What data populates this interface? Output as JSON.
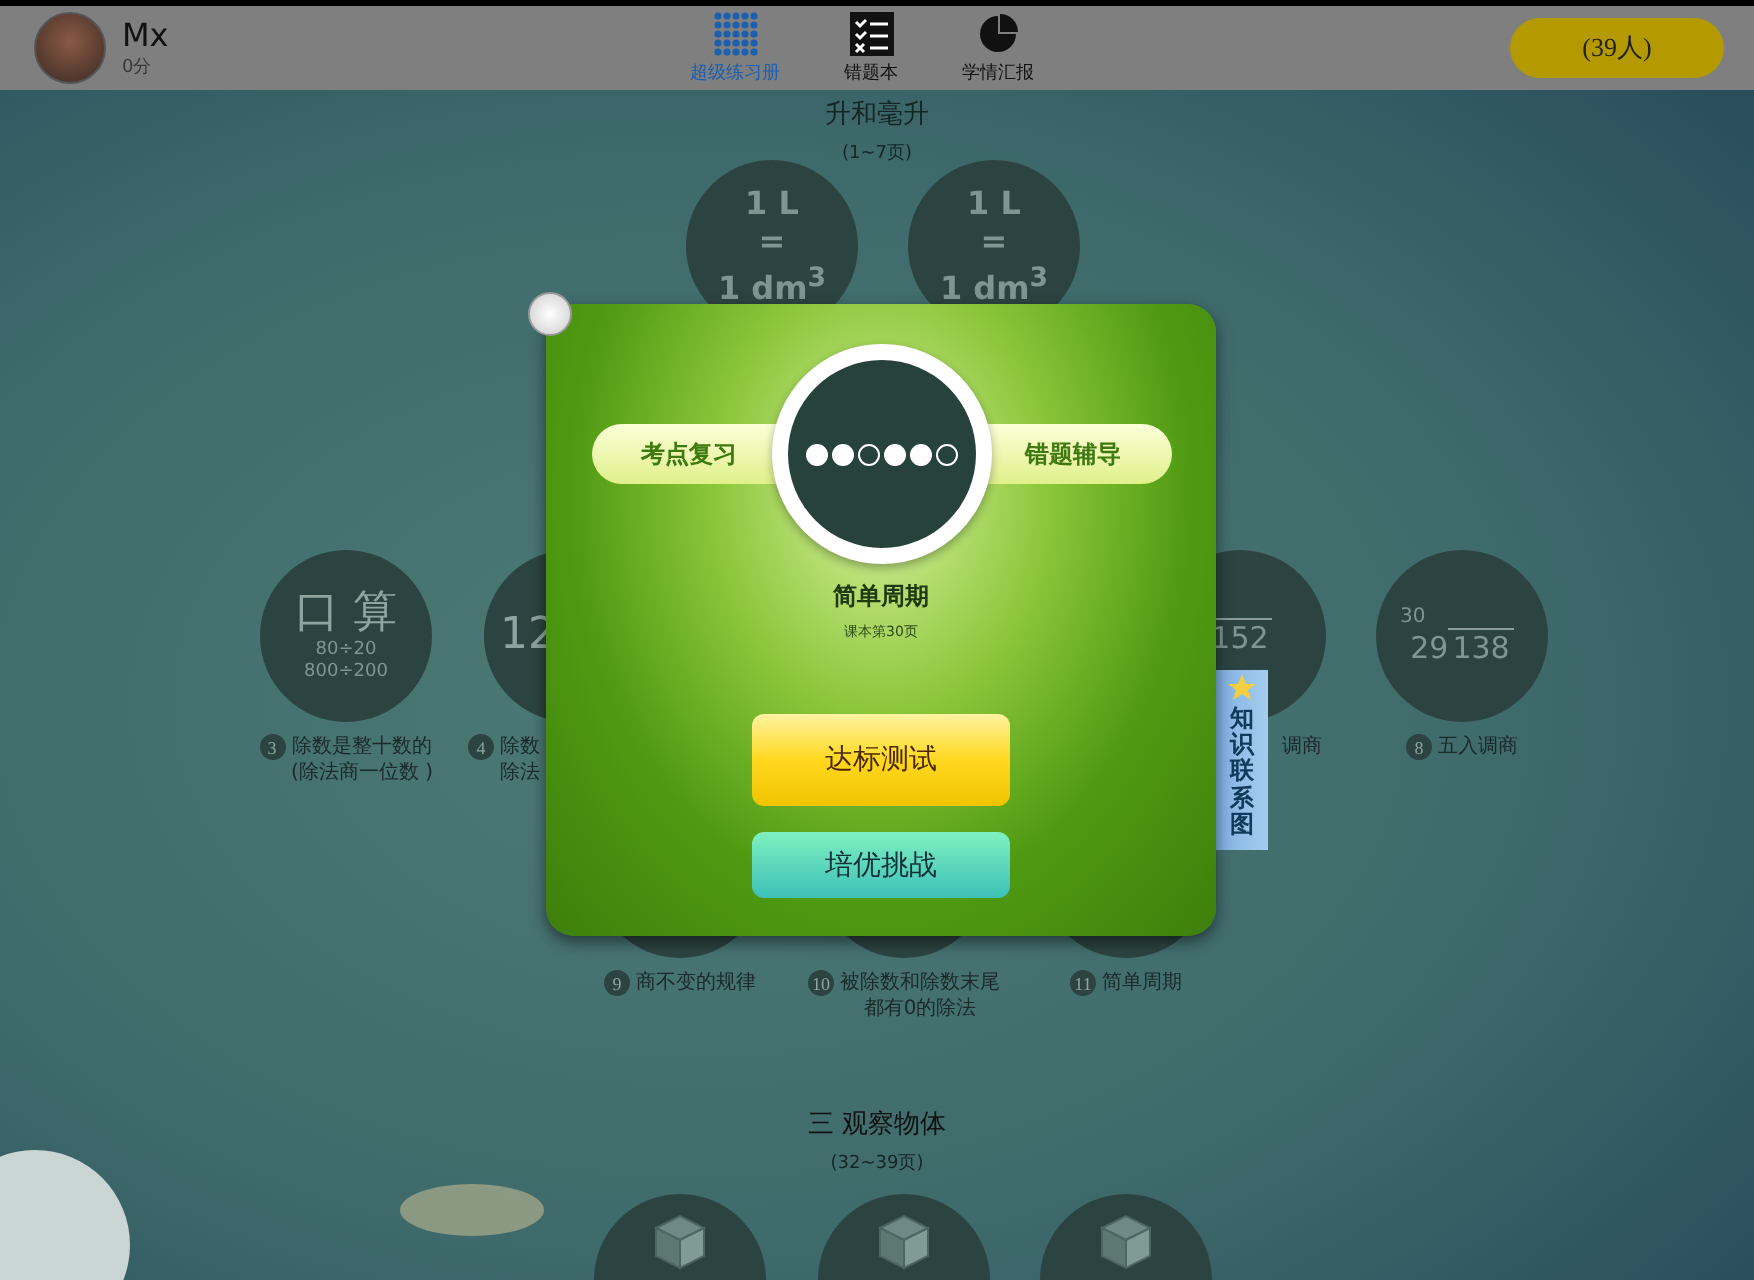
{
  "top_bar": {
    "user": {
      "name": "Mx",
      "score": "0分"
    },
    "tabs": [
      {
        "label": "超级练习册",
        "selected": true
      },
      {
        "label": "错题本",
        "selected": false
      },
      {
        "label": "学情汇报",
        "selected": false
      }
    ],
    "class_button": "(39人)"
  },
  "sections": [
    {
      "title": "升和毫升",
      "pages": "(1~7页)"
    },
    {
      "title": "三 观察物体",
      "pages": "(32~39页)"
    }
  ],
  "nodes": [
    {
      "kind": "formula",
      "lines": [
        "1 L",
        "=",
        "1 dm$^{3}$"
      ]
    },
    {
      "kind": "formula",
      "lines": [
        "1 L",
        "=",
        "1 dm$^{3}$"
      ]
    },
    {
      "kind": "drill",
      "title": "口 算",
      "lines": [
        "80÷20",
        "800÷200"
      ],
      "number": "3",
      "label": [
        "除数是整十数的",
        "(除法商一位数 )"
      ]
    },
    {
      "kind": "partial",
      "title": "12",
      "number": "4",
      "label": [
        "除数",
        "除法"
      ]
    },
    {
      "kind": "division",
      "dividend": "152",
      "label": [
        "调商"
      ]
    },
    {
      "kind": "division",
      "quotient": "30",
      "divisor": "29",
      "dividend": "138",
      "number": "8",
      "label": [
        "五入调商"
      ]
    },
    {
      "kind": "covered",
      "number": "9",
      "label": [
        "商不变的规律"
      ]
    },
    {
      "kind": "covered",
      "number": "10",
      "label": [
        "被除数和除数末尾",
        "都有0的除法"
      ]
    },
    {
      "kind": "covered",
      "number": "11",
      "label": [
        "简单周期"
      ]
    },
    {
      "kind": "cubes"
    },
    {
      "kind": "cubes"
    },
    {
      "kind": "cubes"
    }
  ],
  "dialog": {
    "left_pill": "考点复习",
    "right_pill": "错题辅导",
    "progress": [
      {
        "filled": true
      },
      {
        "filled": true
      },
      {
        "filled": false
      },
      {
        "filled": true
      },
      {
        "filled": true
      },
      {
        "filled": false
      }
    ],
    "title": "简单周期",
    "subtitle": "课本第30页",
    "primary_button": "达标测试",
    "secondary_button": "培优挑战",
    "side_tab": "知识联系图"
  }
}
